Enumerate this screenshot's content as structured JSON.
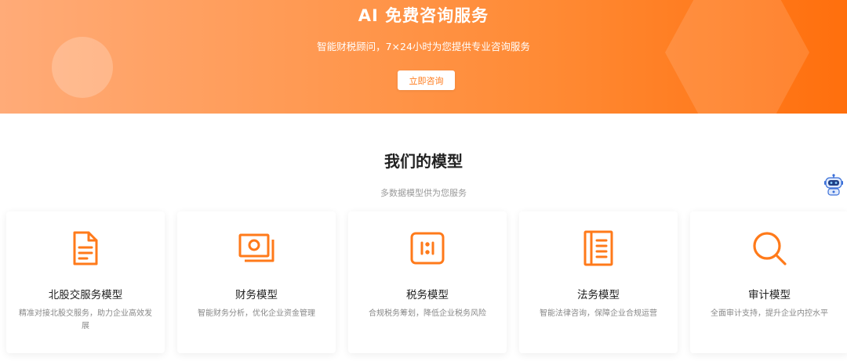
{
  "banner": {
    "title": "AI 免费咨询服务",
    "subtitle": "智能财税顾问，7×24小时为您提供专业咨询服务",
    "button_label": "立即咨询"
  },
  "models_section": {
    "title": "我们的模型",
    "subtitle": "多数据模型供为您服务",
    "cards": [
      {
        "title": "北股交服务模型",
        "desc": "精准对接北股交服务，助力企业高效发展",
        "icon": "document-icon"
      },
      {
        "title": "财务模型",
        "desc": "智能财务分析，优化企业资金管理",
        "icon": "banknote-icon"
      },
      {
        "title": "税务模型",
        "desc": "合规税务筹划，降低企业税务风险",
        "icon": "tax-icon"
      },
      {
        "title": "法务模型",
        "desc": "智能法律咨询，保障企业合规运营",
        "icon": "law-book-icon"
      },
      {
        "title": "审计模型",
        "desc": "全面审计支持，提升企业内控水平",
        "icon": "search-icon"
      }
    ]
  },
  "floating_assistant": {
    "icon": "robot-icon"
  },
  "colors": {
    "accent": "#ff7a1a",
    "banner_start": "#ffab78",
    "banner_end": "#ff6f0d",
    "text_dark": "#222222",
    "text_muted": "#888888"
  }
}
